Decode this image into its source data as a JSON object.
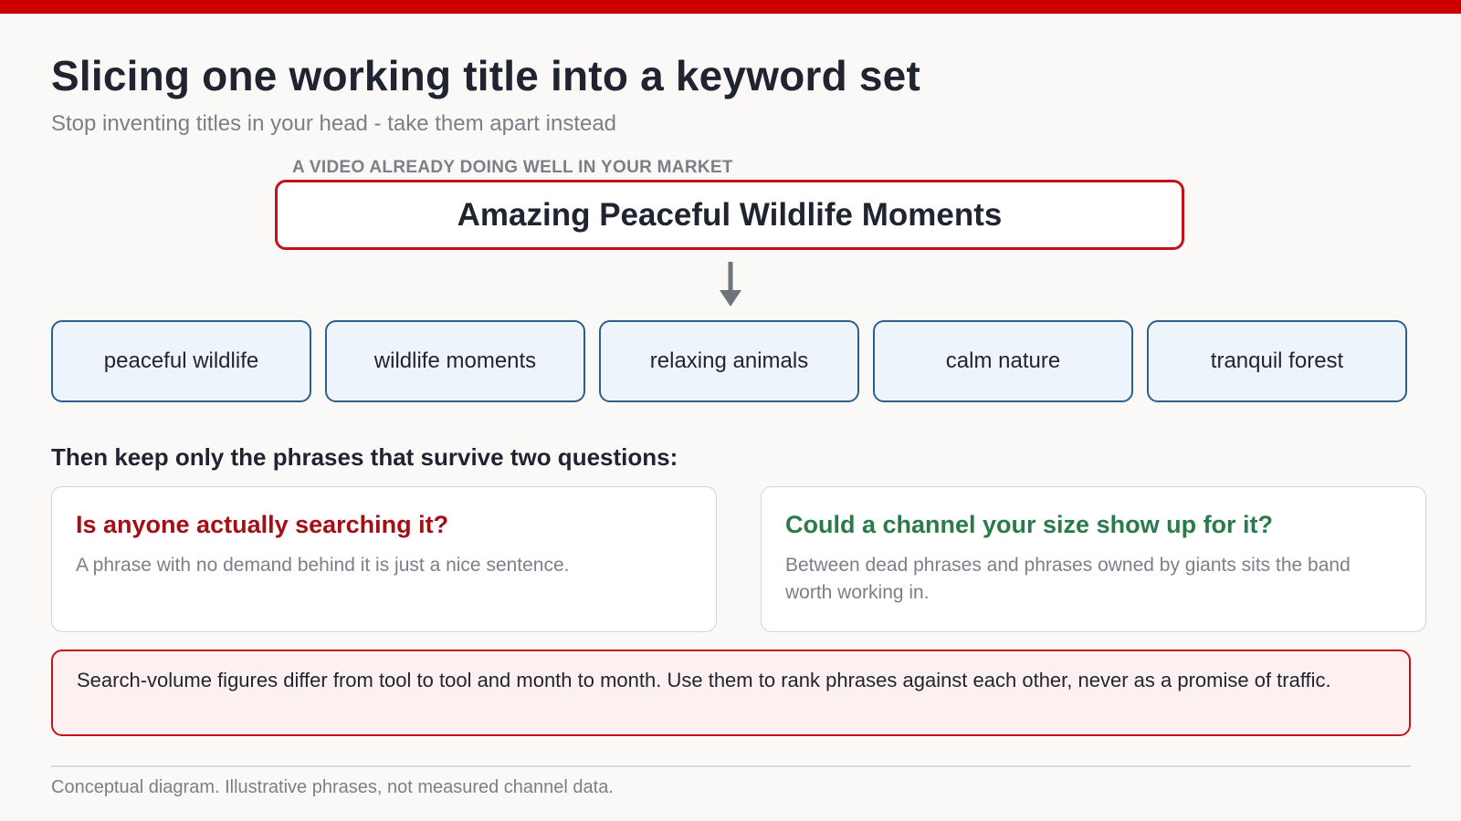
{
  "colors": {
    "accent_red": "#cc0000",
    "chip_border": "#2e5f8a",
    "chip_fill": "#eef4fc",
    "question_1": "#a30f14",
    "question_2": "#2a7a4b",
    "warning_fill": "#fdf0f0"
  },
  "header": {
    "title": "Slicing one working title into a keyword set",
    "subtitle": "Stop inventing titles in your head - take them apart instead"
  },
  "source": {
    "label": "A VIDEO ALREADY DOING WELL IN YOUR MARKET",
    "title": "Amazing Peaceful Wildlife Moments"
  },
  "icons": {
    "arrow": "arrow-down-icon"
  },
  "phrases": [
    "peaceful wildlife",
    "wildlife moments",
    "relaxing animals",
    "calm nature",
    "tranquil forest"
  ],
  "questions": {
    "heading": "Then keep only the phrases that survive two questions:",
    "items": [
      {
        "title": "Is anyone actually searching it?",
        "text": "A phrase with no demand behind it is just a nice sentence."
      },
      {
        "title": "Could a channel your size show up for it?",
        "text": "Between dead phrases and phrases owned by giants sits the band worth working in."
      }
    ]
  },
  "warning": "Search-volume figures differ from tool to tool and month to month. Use them to rank phrases against each other, never as a promise of traffic.",
  "footnote": "Conceptual diagram. Illustrative phrases, not measured channel data."
}
